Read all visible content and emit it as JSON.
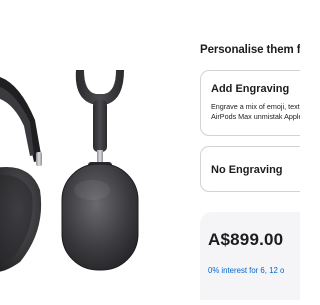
{
  "product": {
    "image_subject": "AirPods Max headphones, space grey"
  },
  "personalise": {
    "title": "Personalise them for",
    "options": [
      {
        "title": "Add Engraving",
        "description": "Engrave a mix of emoji, text, make AirPods Max unmistak Apple."
      },
      {
        "title": "No Engraving"
      }
    ]
  },
  "pricing": {
    "price": "A$899.00",
    "finance_link": "0% interest for 6, 12 o"
  },
  "colors": {
    "link": "#0066cc",
    "card_background": "#f5f5f7",
    "border": "#d2d2d7"
  }
}
